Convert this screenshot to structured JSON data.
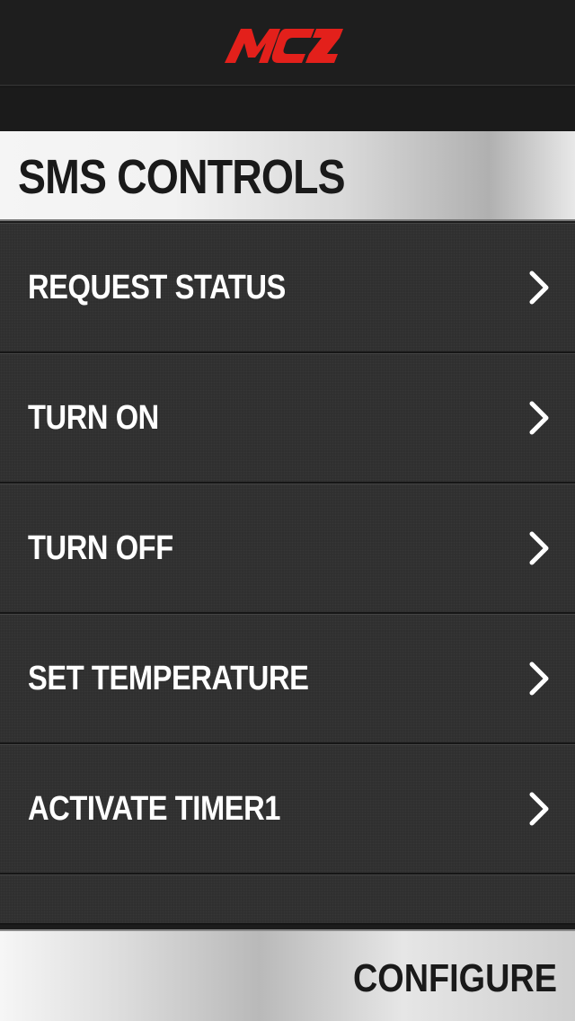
{
  "header": {
    "logo_text": "MCZ",
    "logo_color": "#e3201b"
  },
  "section": {
    "title": "SMS CONTROLS"
  },
  "menu": {
    "items": [
      {
        "label": "REQUEST STATUS"
      },
      {
        "label": "TURN ON"
      },
      {
        "label": "TURN OFF"
      },
      {
        "label": "SET TEMPERATURE"
      },
      {
        "label": "ACTIVATE TIMER1"
      }
    ],
    "chevron_icon": "chevron-right-icon"
  },
  "footer": {
    "configure_label": "CONFIGURE"
  }
}
